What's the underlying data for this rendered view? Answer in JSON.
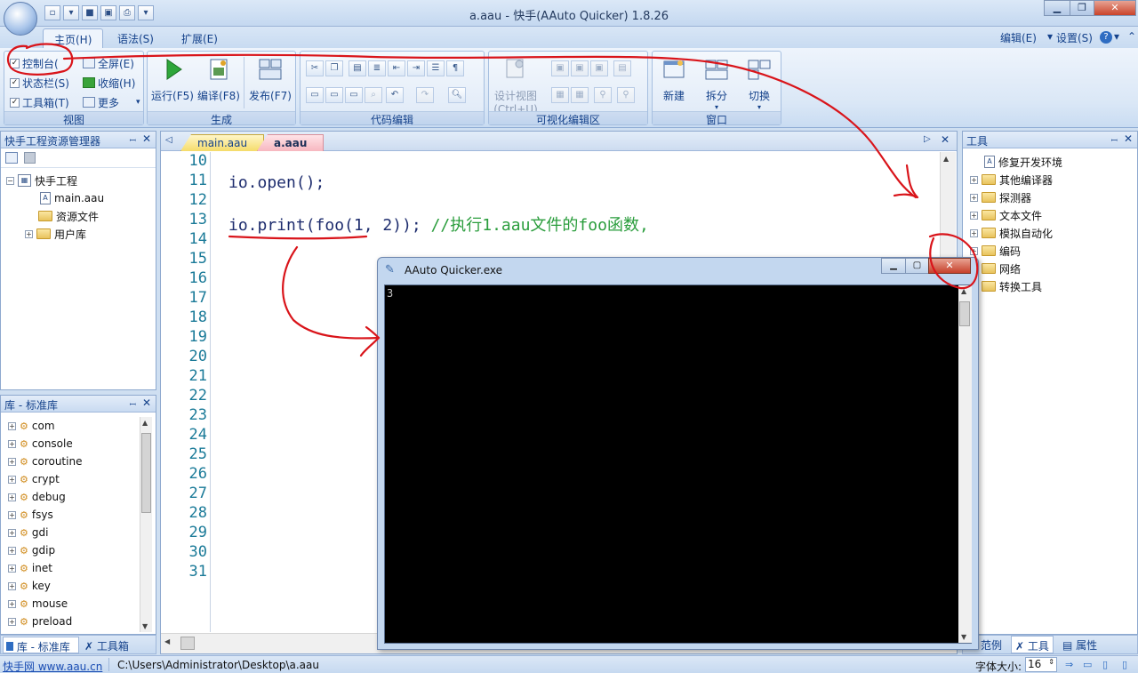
{
  "window": {
    "title": "a.aau - 快手(AAuto Quicker) 1.8.26"
  },
  "ribbon_tabs": [
    {
      "label": "主页(H)",
      "active": true
    },
    {
      "label": "语法(S)",
      "active": false
    },
    {
      "label": "扩展(E)",
      "active": false
    }
  ],
  "ribbon_right": {
    "edit": "编辑(E)",
    "settings": "设置(S)",
    "help": "?"
  },
  "groups": {
    "view": {
      "caption": "视图",
      "console": "控制台(",
      "statusbar": "状态栏(S)",
      "toolbox": "工具箱(T)",
      "fullscreen": "全屏(E)",
      "collapse": "收缩(H)",
      "more": "更多"
    },
    "build": {
      "caption": "生成",
      "run": "运行(F5)",
      "compile": "编译(F8)",
      "publish": "发布(F7)"
    },
    "code_edit": {
      "caption": "代码编辑"
    },
    "visual": {
      "caption": "可视化编辑区",
      "design_view": "设计视图",
      "design_shortcut": "(Ctrl+U)"
    },
    "window": {
      "caption": "窗口",
      "new": "新建",
      "split": "拆分",
      "switch": "切换"
    }
  },
  "project_panel": {
    "title": "快手工程资源管理器",
    "root": "快手工程",
    "items": [
      "main.aau",
      "资源文件",
      "用户库"
    ]
  },
  "library_panel": {
    "title": "库 - 标准库",
    "items": [
      "com",
      "console",
      "coroutine",
      "crypt",
      "debug",
      "fsys",
      "gdi",
      "gdip",
      "inet",
      "key",
      "mouse",
      "preload"
    ],
    "bottom_tabs": [
      "库 - 标准库",
      "工具箱"
    ]
  },
  "editor": {
    "tabs": [
      "main.aau",
      "a.aau"
    ],
    "active_tab": "a.aau",
    "line_numbers": [
      "10",
      "11",
      "12",
      "13",
      "14",
      "15",
      "16",
      "17",
      "18",
      "19",
      "20",
      "21",
      "22",
      "23",
      "24",
      "25",
      "26",
      "27",
      "28",
      "29",
      "30",
      "31"
    ],
    "line11": "io.open();",
    "line13_code": "io.print(foo(1, 2)); ",
    "line13_comment": "//执行1.aau文件的foo函数,"
  },
  "tools_panel": {
    "title": "工具",
    "items": [
      "修复开发环境",
      "其他编译器",
      "探测器",
      "文本文件",
      "模拟自动化",
      "编码",
      "网络",
      "转换工具"
    ],
    "bottom_tabs": [
      "范例",
      "工具",
      "属性"
    ]
  },
  "console_window": {
    "title": "AAuto Quicker.exe",
    "output": "3"
  },
  "statusbar": {
    "site": "快手网 www.aau.cn",
    "path": "C:\\Users\\Administrator\\Desktop\\a.aau",
    "font_size_label": "字体大小:",
    "font_size_value": "16"
  },
  "colors": {
    "annotation": "#d9141a",
    "accent": "#15428b",
    "console_bg": "#000000"
  }
}
